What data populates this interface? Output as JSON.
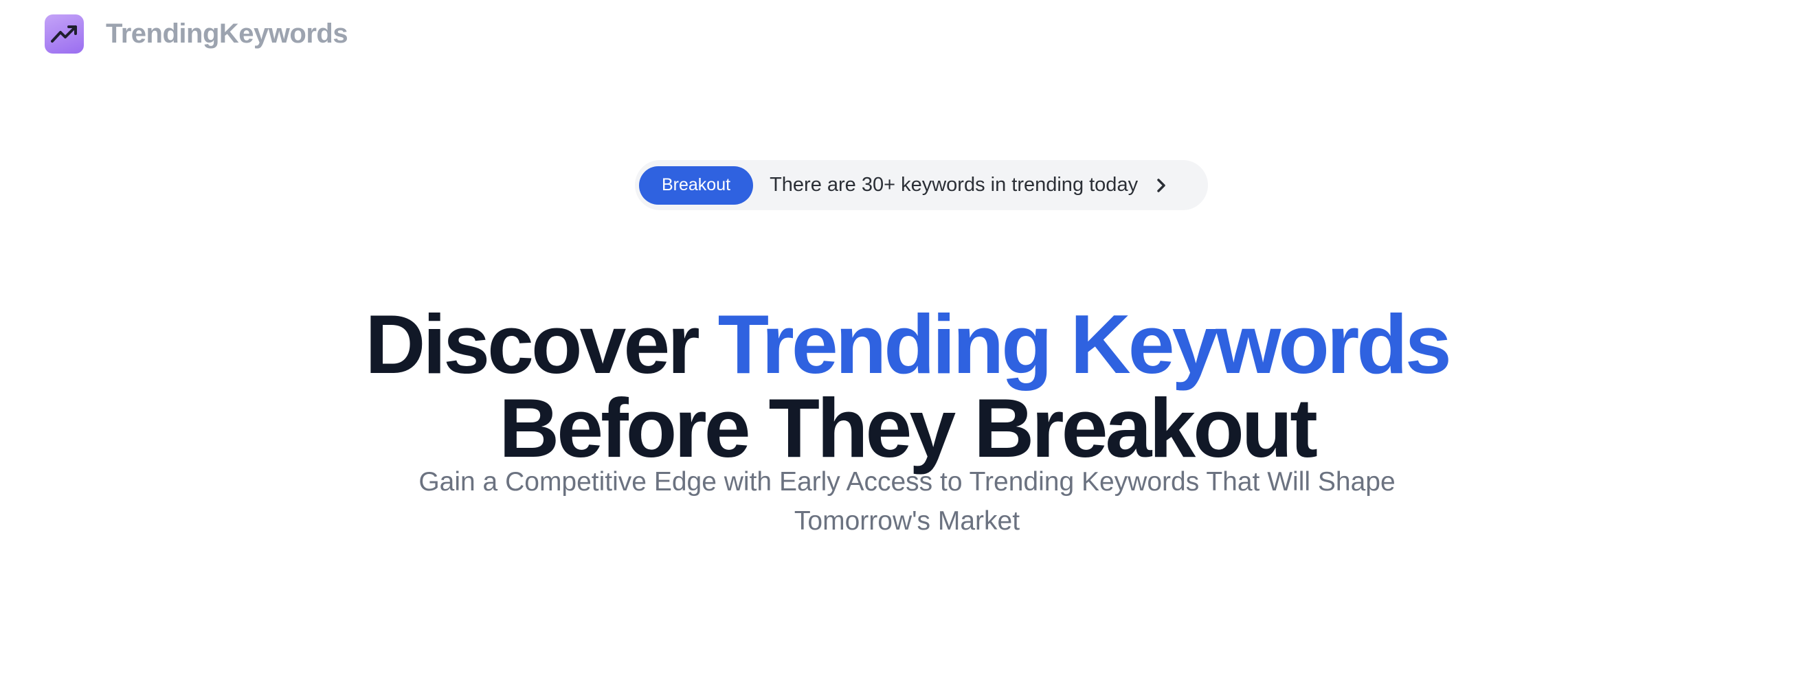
{
  "header": {
    "logo_icon": "trending-up-icon",
    "brand_name": "TrendingKeywords"
  },
  "announcement": {
    "badge_label": "Breakout",
    "text": "There are 30+ keywords in trending today",
    "chevron_icon": "chevron-right-icon"
  },
  "hero": {
    "headline_part1": "Discover ",
    "headline_accent": "Trending Keywords",
    "headline_line2": "Before They Breakout",
    "subheadline": "Gain a Competitive Edge with Early Access to Trending Keywords That Will Shape Tomorrow's Market"
  },
  "colors": {
    "accent": "#2f62e0",
    "headline": "#111827",
    "muted": "#6b7280",
    "brand_text": "#9ca3af",
    "logo_gradient_start": "#c4a3f7",
    "logo_gradient_end": "#9a6ef0"
  }
}
